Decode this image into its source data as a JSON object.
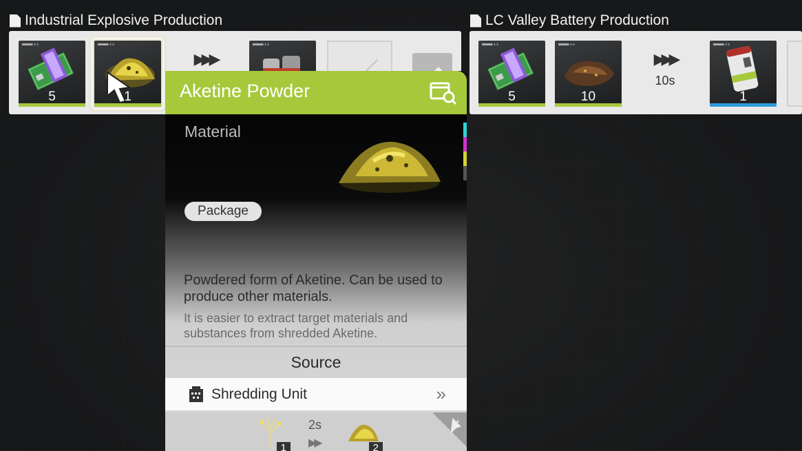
{
  "panels": {
    "left": {
      "title": "Industrial Explosive Production",
      "inputs": [
        {
          "icon": "circuit-board-icon",
          "count": "5"
        },
        {
          "icon": "aketine-powder-icon",
          "count": "1"
        }
      ],
      "output": {
        "icon": "canister-icon"
      }
    },
    "right": {
      "title": "LC Valley Battery Production",
      "inputs": [
        {
          "icon": "circuit-board-icon",
          "count": "5"
        },
        {
          "icon": "ore-chunk-icon",
          "count": "10"
        }
      ],
      "time": "10s",
      "output": {
        "icon": "battery-icon",
        "count": "1"
      }
    }
  },
  "tooltip": {
    "title": "Aketine Powder",
    "type": "Material",
    "tag": "Package",
    "description": "Powdered form of Aketine. Can be used to produce other materials.",
    "flavor": "It is easier to extract target materials and substances from shredded Aketine.",
    "source_heading": "Source",
    "source": {
      "name": "Shredding Unit",
      "icon": "shredder-icon"
    },
    "source_recipe": {
      "input_count": "1",
      "time": "2s",
      "output_count": "2"
    }
  },
  "colors": {
    "accent_green": "#a6c93c",
    "accent_blue": "#2f9be0",
    "strip": [
      "#2fd3d3",
      "#d32fd3",
      "#d3d32f",
      "#555555"
    ]
  }
}
